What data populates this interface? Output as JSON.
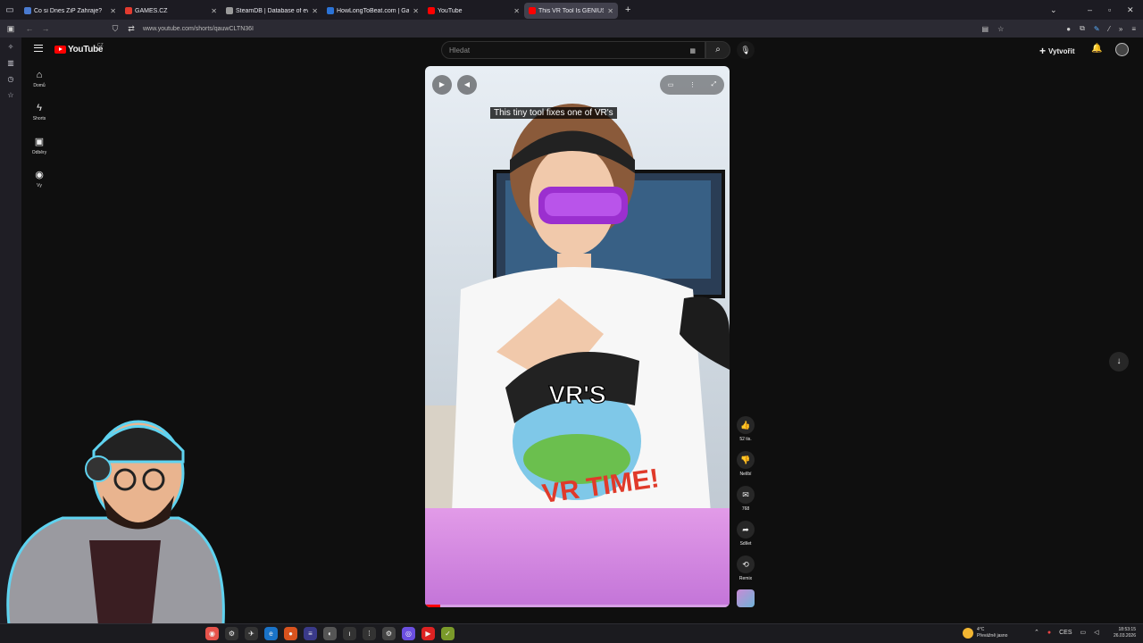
{
  "browser": {
    "tabs": [
      {
        "title": "Co si Dnes ZiP Zahraje?",
        "favicon_color": "#4a7bd1",
        "active": false
      },
      {
        "title": "GAMES.CZ",
        "favicon_color": "#e33b2f",
        "active": false
      },
      {
        "title": "SteamDB | Database of everyth",
        "favicon_color": "#9a9a9a",
        "active": false
      },
      {
        "title": "HowLongToBeat.com | Game Le",
        "favicon_color": "#2b73d6",
        "active": false
      },
      {
        "title": "YouTube",
        "favicon_color": "#ff0000",
        "active": false
      },
      {
        "title": "This VR Tool Is GENIUS! - YouT",
        "favicon_color": "#ff0000",
        "active": true
      }
    ],
    "url": "www.youtube.com/shorts/qauwCLTN36I"
  },
  "youtube": {
    "logo_text": "YouTube",
    "country_code": "CZ",
    "search_placeholder": "Hledat",
    "create_label": "Vytvořit",
    "nav": [
      {
        "icon": "home-icon",
        "glyph": "⌂",
        "label": "Domů"
      },
      {
        "icon": "shorts-icon",
        "glyph": "ϟ",
        "label": "Shorts"
      },
      {
        "icon": "subscriptions-icon",
        "glyph": "▣",
        "label": "Odběry"
      },
      {
        "icon": "you-icon",
        "glyph": "◉",
        "label": "Vy"
      }
    ]
  },
  "video": {
    "caption": "This tiny tool fixes one of VR's",
    "overlay_text": "VR'S",
    "progress_fraction": 0.05
  },
  "actions": [
    {
      "name": "like-button",
      "icon": "thumbs-up-icon",
      "glyph": "👍",
      "label": "52 tis."
    },
    {
      "name": "dislike-button",
      "icon": "thumbs-down-icon",
      "glyph": "👎",
      "label": "Nelíbí"
    },
    {
      "name": "comments-button",
      "icon": "comment-icon",
      "glyph": "✉",
      "label": "768"
    },
    {
      "name": "share-button",
      "icon": "share-icon",
      "glyph": "➦",
      "label": "Sdílet"
    },
    {
      "name": "remix-button",
      "icon": "remix-icon",
      "glyph": "⟲",
      "label": "Remix"
    }
  ],
  "taskbar": {
    "weather_temp": "4°C",
    "weather_desc": "Převážně jasno",
    "language": "CES",
    "time": "18:53:15",
    "date": "26.03.2026"
  },
  "colors": {
    "accent": "#ff0000",
    "background": "#0f0f0f",
    "chip": "#272727"
  }
}
